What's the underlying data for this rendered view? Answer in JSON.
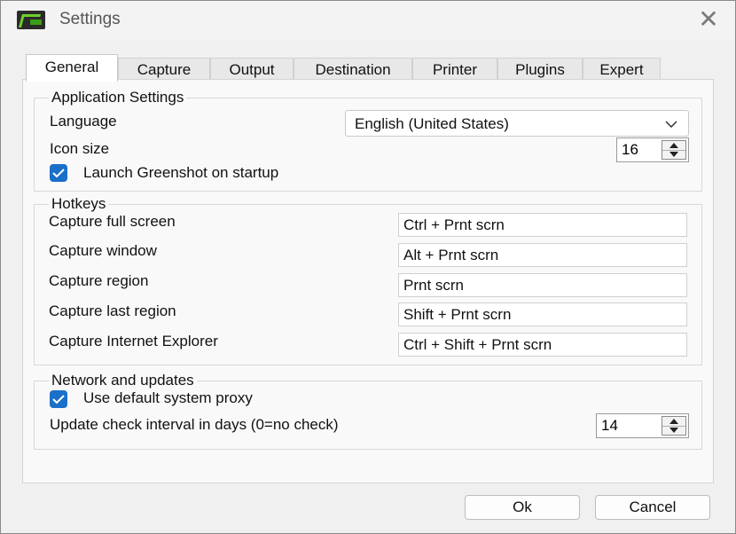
{
  "window": {
    "title": "Settings",
    "app_icon": "greenshot-logo-icon",
    "close_icon": "close-icon"
  },
  "tabs": [
    {
      "label": "General",
      "active": true
    },
    {
      "label": "Capture",
      "active": false
    },
    {
      "label": "Output",
      "active": false
    },
    {
      "label": "Destination",
      "active": false
    },
    {
      "label": "Printer",
      "active": false
    },
    {
      "label": "Plugins",
      "active": false
    },
    {
      "label": "Expert",
      "active": false
    }
  ],
  "application": {
    "group_title": "Application Settings",
    "language_label": "Language",
    "language_value": "English (United States)",
    "icon_size_label": "Icon size",
    "icon_size_value": "16",
    "launch_label": "Launch Greenshot on startup",
    "launch_checked": true
  },
  "hotkeys": {
    "group_title": "Hotkeys",
    "items": [
      {
        "label": "Capture full screen",
        "value": "Ctrl + Prnt scrn"
      },
      {
        "label": "Capture window",
        "value": "Alt + Prnt scrn"
      },
      {
        "label": "Capture region",
        "value": "Prnt scrn"
      },
      {
        "label": "Capture last region",
        "value": "Shift + Prnt scrn"
      },
      {
        "label": "Capture Internet Explorer",
        "value": "Ctrl + Shift + Prnt scrn"
      }
    ]
  },
  "network": {
    "group_title": "Network and updates",
    "proxy_label": "Use default system proxy",
    "proxy_checked": true,
    "interval_label": "Update check interval in days (0=no check)",
    "interval_value": "14"
  },
  "buttons": {
    "ok_label": "Ok",
    "cancel_label": "Cancel"
  },
  "colors": {
    "accent": "#1a6fc9",
    "logo_green": "#6fcf2a"
  }
}
